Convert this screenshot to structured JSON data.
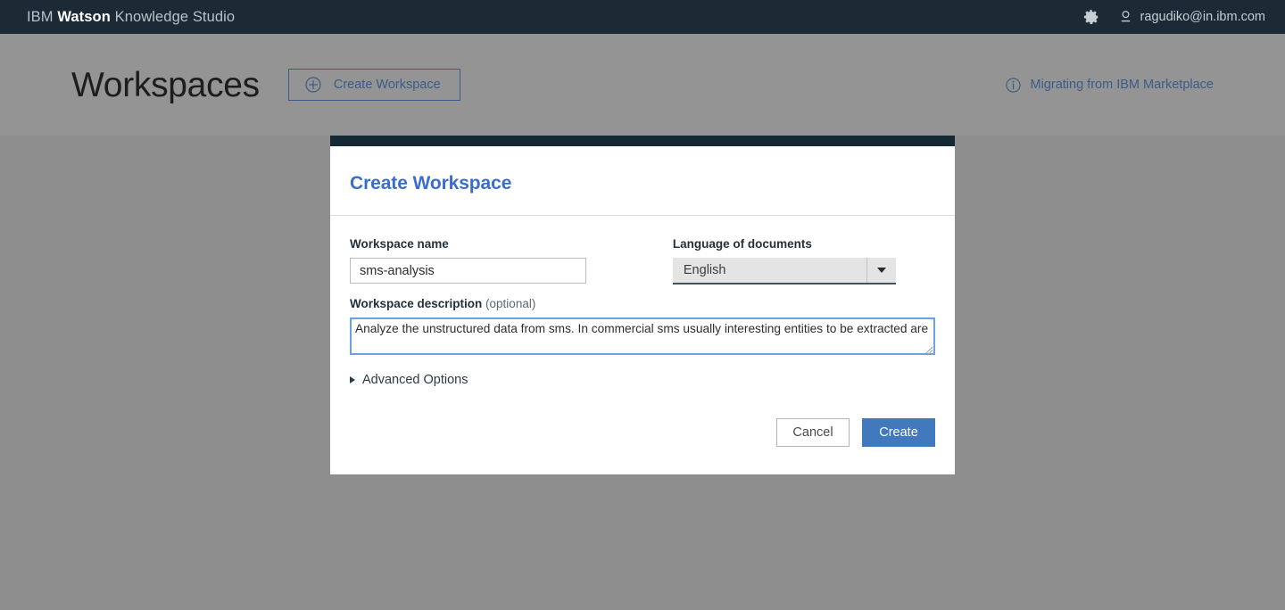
{
  "appbar": {
    "brand_prefix": "IBM ",
    "brand_bold": "Watson",
    "brand_suffix": " Knowledge Studio",
    "gear_icon": "gear-icon",
    "user_icon": "user-icon",
    "user_email": "ragudiko@in.ibm.com",
    "background_color": "#1b2a35"
  },
  "page_header": {
    "title": "Workspaces",
    "create_button": {
      "label": "Create Workspace",
      "icon": "plus-circle-icon",
      "accent_color": "#3b5c87"
    },
    "migrating_link": {
      "label": "Migrating from IBM Marketplace",
      "icon": "info-icon",
      "accent_color": "#3b5c87"
    },
    "background_color": "#949494"
  },
  "overlay": {
    "background_color": "#8e8e8e"
  },
  "modal": {
    "topbar_color": "#152935",
    "title": "Create Workspace",
    "title_color": "#3b6ecc",
    "workspace_name": {
      "label": "Workspace name",
      "value": "sms-analysis",
      "placeholder": ""
    },
    "language": {
      "label": "Language of documents",
      "selected": "English",
      "options": [
        "English"
      ],
      "caret_icon": "caret-down-icon"
    },
    "description": {
      "label": "Workspace description ",
      "optional_suffix": "(optional)",
      "value": "Analyze the unstructured data from sms. In commercial sms usually interesting entities to be extracted are",
      "placeholder": "",
      "focused": true,
      "focus_border_color": "#6aa3e0",
      "resize_grip_icon": "resize-grip-icon"
    },
    "advanced_options": {
      "label": "Advanced Options",
      "icon": "triangle-right-icon",
      "expanded": false
    },
    "buttons": {
      "cancel": "Cancel",
      "create": "Create",
      "create_color": "#4178be"
    }
  }
}
